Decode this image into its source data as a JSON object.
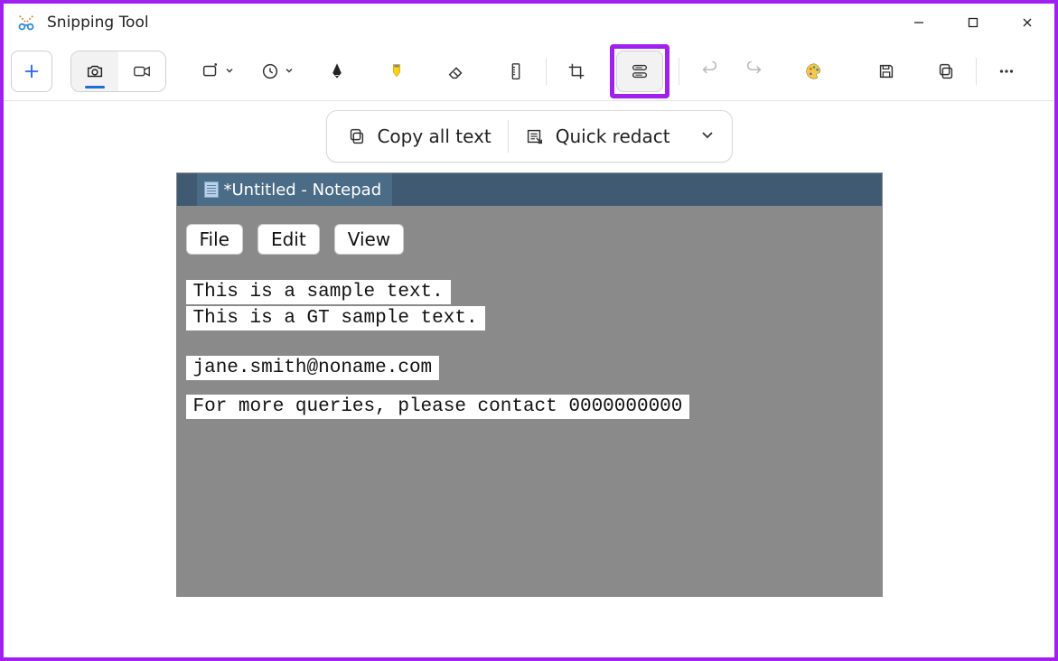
{
  "window": {
    "title": "Snipping Tool"
  },
  "toolbar": {
    "new": "+",
    "mode_camera": "camera-icon",
    "mode_video": "video-icon",
    "shape": "shape-icon",
    "delay": "delay-icon",
    "pen": "pen-icon",
    "highlighter": "highlighter-icon",
    "eraser": "eraser-icon",
    "ruler": "ruler-icon",
    "crop": "crop-icon",
    "text_actions": "text-actions-icon",
    "undo": "undo-icon",
    "redo": "redo-icon",
    "paint": "paint-icon",
    "save": "save-icon",
    "copy": "copy-icon",
    "more": "more-icon"
  },
  "actionbar": {
    "copy_all": "Copy all text",
    "quick_redact": "Quick redact"
  },
  "screenshot": {
    "title": "*Untitled - Notepad",
    "menus": {
      "file": "File",
      "edit": "Edit",
      "view": "View"
    },
    "line1": "This is a sample text.",
    "line2": "This is a GT sample text.",
    "email": "jane.smith@noname.com",
    "contact": "For more queries, please contact 0000000000"
  }
}
